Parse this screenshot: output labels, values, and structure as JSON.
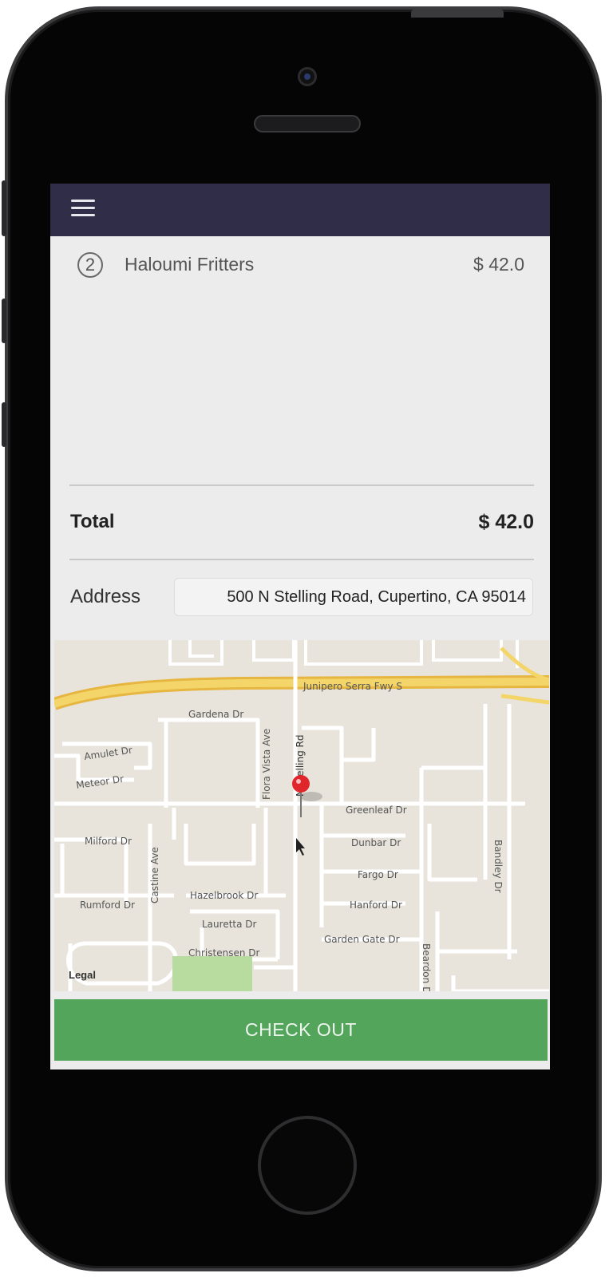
{
  "navbar": {
    "menu_icon": "hamburger-menu-icon",
    "color": "#2f2d47"
  },
  "order": {
    "items": [
      {
        "quantity": "2",
        "name": "Haloumi Fritters",
        "price": "$ 42.0"
      }
    ],
    "total_label": "Total",
    "total_value": "$ 42.0"
  },
  "address": {
    "label": "Address",
    "value": "500 N Stelling Road, Cupertino, CA 95014"
  },
  "map": {
    "streets": [
      "Junipero Serra Fwy S",
      "Gardena Dr",
      "Amulet Dr",
      "Meteor Dr",
      "Flora Vista Ave",
      "N Stelling Rd",
      "Greenleaf Dr",
      "Milford Dr",
      "Dunbar Dr",
      "Fargo Dr",
      "Castine Ave",
      "Bandley Dr",
      "Rumford Dr",
      "Hazelbrook Dr",
      "Hanford Dr",
      "Lauretta Dr",
      "Garden Gate Dr",
      "Christensen Dr",
      "Beardon Dr"
    ],
    "legal": "Legal",
    "pin_color": "#e0262b"
  },
  "checkout": {
    "label": "CHECK OUT",
    "color": "#52a55a"
  }
}
